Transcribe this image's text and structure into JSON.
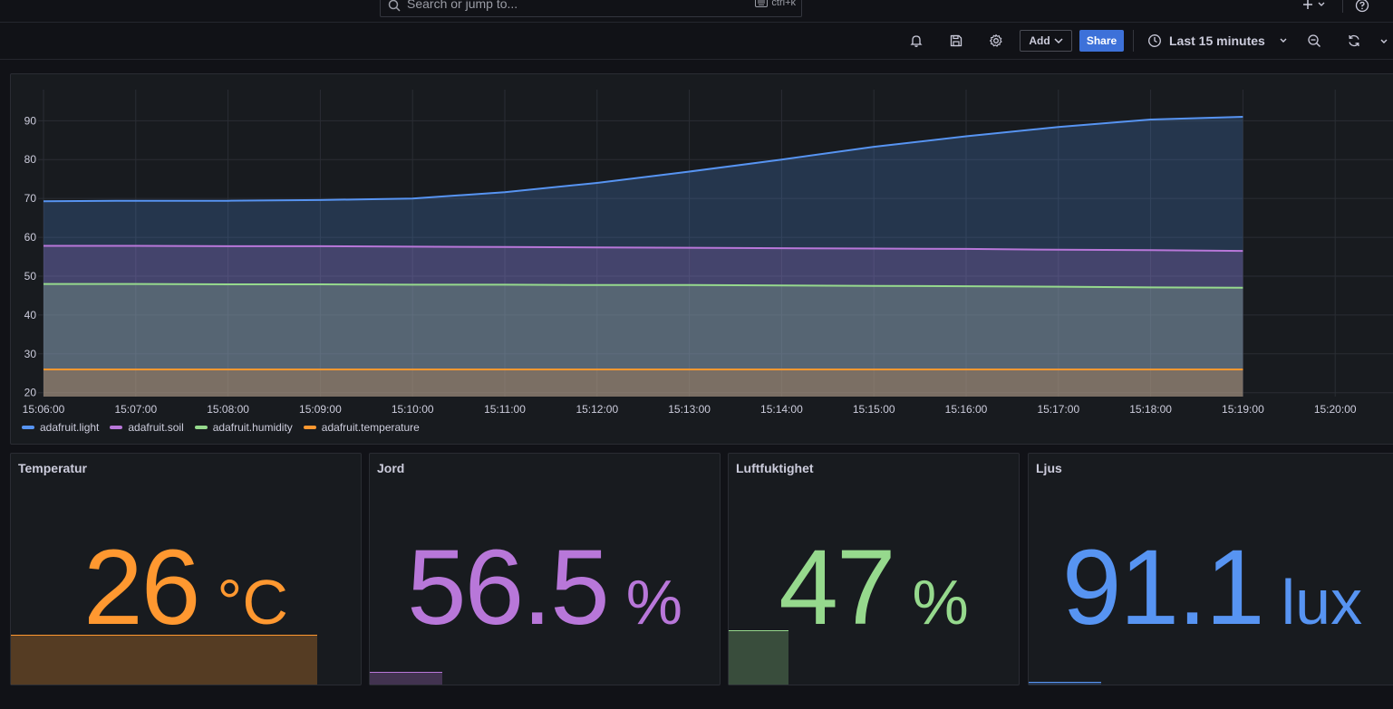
{
  "search": {
    "placeholder": "Search or jump to...",
    "shortcut": "ctrl+k"
  },
  "toolbar": {
    "add_label": "Add",
    "share_label": "Share",
    "time_range": "Last 15 minutes"
  },
  "icons": {
    "alert": "bell-icon",
    "save": "save-icon",
    "settings": "gear-icon",
    "zoom_out": "zoom-out-icon",
    "refresh": "refresh-icon",
    "help": "help-icon",
    "plus": "plus-icon"
  },
  "colors": {
    "light": "#5794f2",
    "soil": "#b877d9",
    "humidity": "#96d98d",
    "temperature": "#ff9830",
    "share": "#3d71d9"
  },
  "chart_data": {
    "type": "area",
    "title": "",
    "xlabel": "",
    "ylabel": "",
    "x": [
      "15:06:00",
      "15:07:00",
      "15:08:00",
      "15:09:00",
      "15:10:00",
      "15:11:00",
      "15:12:00",
      "15:13:00",
      "15:14:00",
      "15:15:00",
      "15:16:00",
      "15:17:00",
      "15:18:00",
      "15:19:00",
      "15:20:00"
    ],
    "ylim": [
      19,
      98
    ],
    "yticks": [
      20,
      30,
      40,
      50,
      60,
      70,
      80,
      90
    ],
    "grid": true,
    "legend_position": "bottom-left",
    "series": [
      {
        "name": "adafruit.light",
        "color": "#5794f2",
        "values": [
          69.3,
          69.4,
          69.4,
          69.6,
          70.0,
          71.6,
          74.0,
          76.9,
          80.0,
          83.3,
          86.0,
          88.4,
          90.3,
          91.0
        ]
      },
      {
        "name": "adafruit.soil",
        "color": "#b877d9",
        "values": [
          57.8,
          57.8,
          57.7,
          57.7,
          57.6,
          57.5,
          57.4,
          57.3,
          57.2,
          57.1,
          57.0,
          56.8,
          56.7,
          56.5
        ]
      },
      {
        "name": "adafruit.humidity",
        "color": "#96d98d",
        "values": [
          48.0,
          48.0,
          47.9,
          47.9,
          47.8,
          47.8,
          47.7,
          47.7,
          47.6,
          47.5,
          47.4,
          47.3,
          47.1,
          47.0
        ]
      },
      {
        "name": "adafruit.temperature",
        "color": "#ff9830",
        "values": [
          26,
          26,
          26,
          26,
          26,
          26,
          26,
          26,
          26,
          26,
          26,
          26,
          26,
          26
        ]
      }
    ]
  },
  "stats": [
    {
      "title": "Temperatur",
      "value": "26",
      "unit": "°C",
      "color": "#ff9830",
      "level": 0.21
    },
    {
      "title": "Jord",
      "value": "56.5",
      "unit": "%",
      "color": "#b877d9",
      "level": 0.05
    },
    {
      "title": "Luftfuktighet",
      "value": "47",
      "unit": "%",
      "color": "#96d98d",
      "level": 0.23
    },
    {
      "title": "Ljus",
      "value": "91.1",
      "unit": "lux",
      "color": "#5794f2",
      "level": 0.005
    }
  ]
}
